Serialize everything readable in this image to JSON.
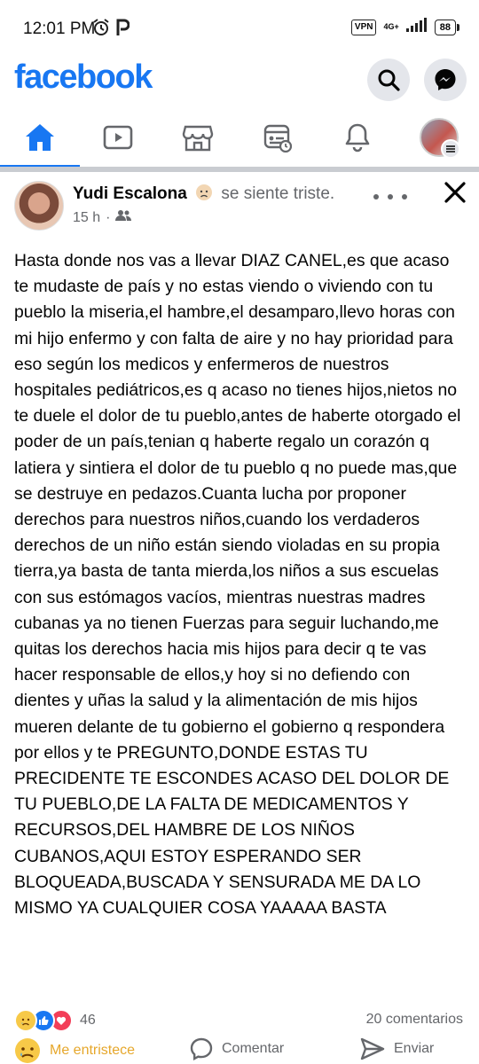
{
  "status_bar": {
    "time": "12:01 PM",
    "vpn": "VPN",
    "network": "4G+",
    "battery": "88"
  },
  "header": {
    "logo": "facebook",
    "icons": [
      "search-icon",
      "messenger-icon"
    ]
  },
  "tabs": [
    {
      "name": "home-icon",
      "active": true
    },
    {
      "name": "watch-icon",
      "active": false
    },
    {
      "name": "marketplace-icon",
      "active": false
    },
    {
      "name": "feeds-icon",
      "active": false
    },
    {
      "name": "notifications-bell-icon",
      "active": false
    },
    {
      "name": "profile-menu-icon",
      "active": false
    }
  ],
  "post": {
    "author": "Yudi Escalona",
    "feeling": "se siente triste.",
    "time": "15 h",
    "body": "Hasta donde nos vas a llevar DIAZ CANEL,es que acaso te mudaste de país y no estas viendo o viviendo con tu pueblo la miseria,el hambre,el desamparo,llevo horas con mi hijo enfermo y con falta de aire y no hay prioridad para eso según los medicos y enfermeros de nuestros hospitales pediátricos,es q acaso no tienes hijos,nietos no te duele el dolor de tu pueblo,antes de haberte otorgado el poder de un país,tenian q haberte regalo un corazón q latiera y sintiera el dolor de tu pueblo q no puede mas,que se destruye en pedazos.Cuanta lucha por proponer derechos para nuestros niños,cuando los verdaderos derechos de un niño están siendo violadas en su propia tierra,ya basta de tanta mierda,los niños a sus escuelas con sus estómagos vacíos, mientras nuestras madres cubanas ya no tienen Fuerzas para seguir luchando,me quitas los derechos hacia mis hijos para decir q te vas hacer responsable de ellos,y hoy si no defiendo con dientes y uñas la salud y la alimentación de mis hijos mueren delante de tu gobierno el gobierno q respondera por ellos y te PREGUNTO,DONDE ESTAS TU PRECIDENTE TE ESCONDES ACASO DEL DOLOR DE TU PUEBLO,DE LA FALTA DE MEDICAMENTOS Y RECURSOS,DEL HAMBRE  DE LOS NIÑOS CUBANOS,AQUI ESTOY ESPERANDO SER BLOQUEADA,BUSCADA Y SENSURADA ME DA LO MISMO YA CUALQUIER COSA YAAAAA BASTA",
    "reaction_count": "46",
    "comments": "20 comentarios",
    "reaction_label": "Me entristece",
    "comment_label": "Comentar",
    "share_label": "Enviar"
  },
  "colors": {
    "brand": "#1877f2",
    "sad": "#e6a72b",
    "love": "#f33e58",
    "secondary_text": "#65676b"
  }
}
